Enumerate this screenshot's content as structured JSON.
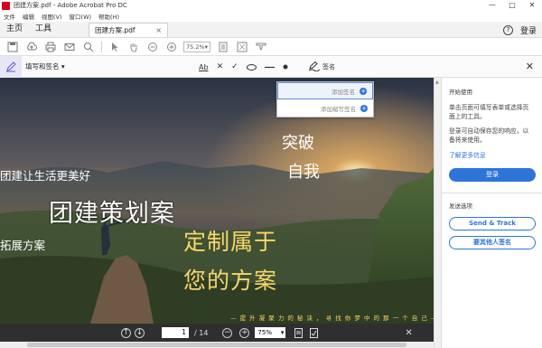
{
  "window": {
    "title": "团建方案.pdf - Adobe Acrobat Pro DC",
    "minimize": "—",
    "maximize": "□",
    "close": "✕"
  },
  "menu": [
    "文件",
    "编辑",
    "视图(V)",
    "窗口(W)",
    "帮助(H)"
  ],
  "tabs": {
    "home": "主页",
    "tools": "工具",
    "document": "团建方案.pdf",
    "close": "×",
    "help": "?",
    "signin": "登录"
  },
  "toolbar": {
    "zoom": "75.2%"
  },
  "fillsign": {
    "label": "填写和签名",
    "text_tool": "Ab",
    "cross": "✕",
    "check": "✓",
    "sign_label": "签名"
  },
  "signature_menu": {
    "add_signature": "添加签名",
    "add_initials": "添加缩写签名"
  },
  "document_text": {
    "line1": "团建让生活更美好",
    "headline": "团建策划案",
    "line3": "拓展方案",
    "gold1": "定制属于",
    "gold2": "您的方案",
    "white1": "突破",
    "white2": "自我",
    "bottom": "— 提 升 凝 聚 力 的 秘 诀 ， 寻 找 你 梦 中 的 那 一 个 自 己 —"
  },
  "pagebar": {
    "page": "1",
    "total": "/ 14",
    "zoom": "75%"
  },
  "rightpane": {
    "heading": "开始使用",
    "desc": "单击页面可填写表单或选择页面上的工具。",
    "login_desc": "登录可自动保存您的响应，以备将来使用。",
    "learn_more": "了解更多信息",
    "login_btn": "登录",
    "send_heading": "发送选项",
    "send_track": "Send & Track",
    "request_sign": "要其他人签名"
  },
  "colors": {
    "accent": "#2d74d9",
    "gold": "#f7d66a",
    "fill_icon": "#5a5ad2"
  }
}
